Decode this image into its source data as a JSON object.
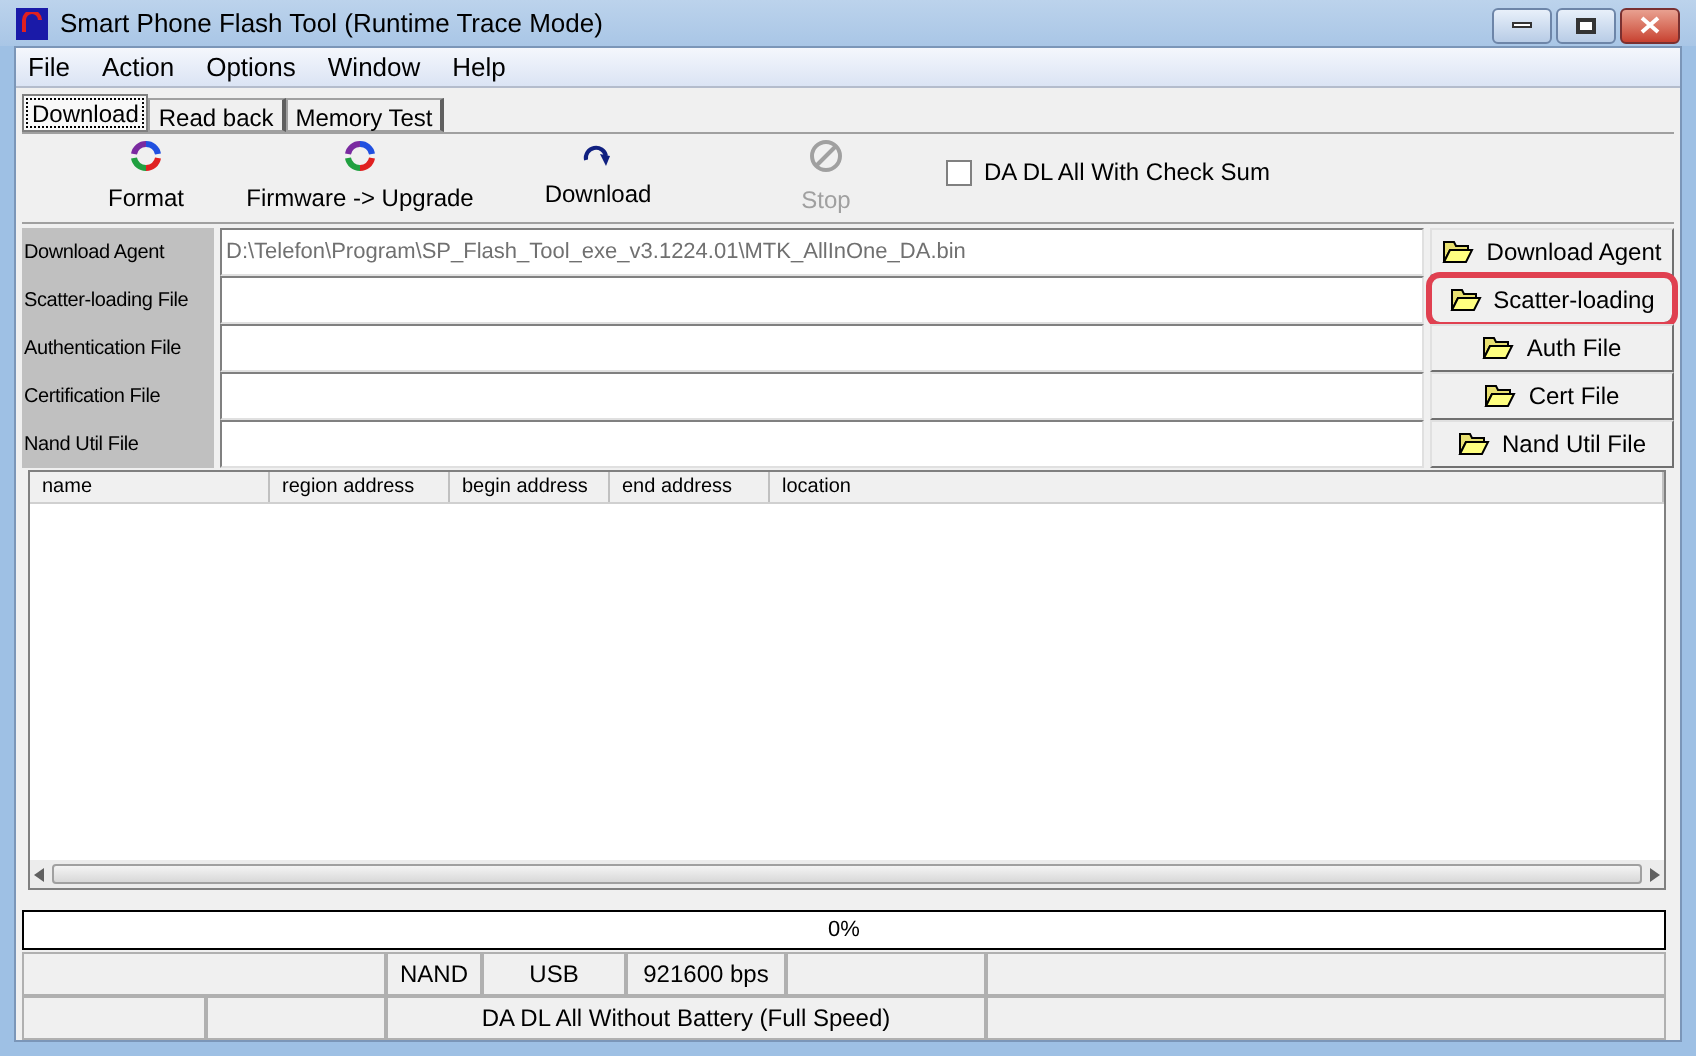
{
  "window": {
    "title": "Smart Phone Flash Tool (Runtime Trace Mode)"
  },
  "menu": [
    "File",
    "Action",
    "Options",
    "Window",
    "Help"
  ],
  "tabs": [
    {
      "label": "Download",
      "selected": true
    },
    {
      "label": "Read back",
      "selected": false
    },
    {
      "label": "Memory Test",
      "selected": false
    }
  ],
  "toolbar": [
    {
      "kind": "format",
      "label": "Format",
      "disabled": false
    },
    {
      "kind": "upgrade",
      "label": "Firmware -> Upgrade",
      "disabled": false
    },
    {
      "kind": "download",
      "label": "Download",
      "disabled": false
    },
    {
      "kind": "stop",
      "label": "Stop",
      "disabled": true
    }
  ],
  "checksum_option": {
    "label": "DA DL All With Check Sum",
    "checked": false
  },
  "files": [
    {
      "label": "Download Agent",
      "value": "D:\\Telefon\\Program\\SP_Flash_Tool_exe_v3.1224.01\\MTK_AllInOne_DA.bin",
      "button": "Download Agent",
      "highlighted": false
    },
    {
      "label": "Scatter-loading File",
      "button": "Scatter-loading",
      "highlighted": true
    },
    {
      "label": "Authentication File",
      "button": "Auth File",
      "highlighted": false
    },
    {
      "label": "Certification File",
      "button": "Cert File",
      "highlighted": false
    },
    {
      "label": "Nand Util File",
      "button": "Nand Util File",
      "highlighted": false
    }
  ],
  "table": {
    "columns": [
      "name",
      "region address",
      "begin address",
      "end address",
      "location"
    ]
  },
  "progress": {
    "level": 0,
    "reading": "0%"
  },
  "status_bar": {
    "row_1": [
      "NAND",
      "USB",
      "921600 bps"
    ],
    "row_2": [
      "DA DL All Without Battery (Full Speed)"
    ]
  }
}
